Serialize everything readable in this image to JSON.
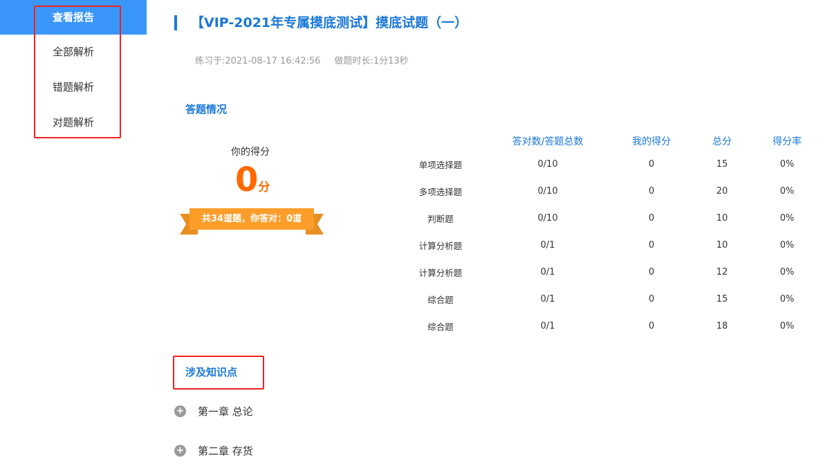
{
  "sidebar": {
    "items": [
      {
        "label": "查看报告"
      },
      {
        "label": "全部解析"
      },
      {
        "label": "错题解析"
      },
      {
        "label": "对题解析"
      }
    ]
  },
  "header": {
    "title": "【VIP-2021年专属摸底测试】摸底试题（一）",
    "practice_time": "练习于:2021-08-17 16:42:56",
    "duration": "做题时长:1分13秒"
  },
  "answers": {
    "section_title": "答题情况",
    "score_label": "你的得分",
    "score": "0",
    "score_unit": "分",
    "summary": "共34道题，你答对：0道",
    "columns": [
      "",
      "答对数/答题总数",
      "我的得分",
      "总分",
      "得分率"
    ],
    "rows": [
      [
        "单项选择题",
        "0/10",
        "0",
        "15",
        "0%"
      ],
      [
        "多项选择题",
        "0/10",
        "0",
        "20",
        "0%"
      ],
      [
        "判断题",
        "0/10",
        "0",
        "10",
        "0%"
      ],
      [
        "计算分析题",
        "0/1",
        "0",
        "10",
        "0%"
      ],
      [
        "计算分析题",
        "0/1",
        "0",
        "12",
        "0%"
      ],
      [
        "综合题",
        "0/1",
        "0",
        "15",
        "0%"
      ],
      [
        "综合题",
        "0/1",
        "0",
        "18",
        "0%"
      ]
    ]
  },
  "knowledge": {
    "section_title": "涉及知识点",
    "items": [
      {
        "label": "第一章 总论"
      },
      {
        "label": "第二章 存货"
      }
    ]
  }
}
